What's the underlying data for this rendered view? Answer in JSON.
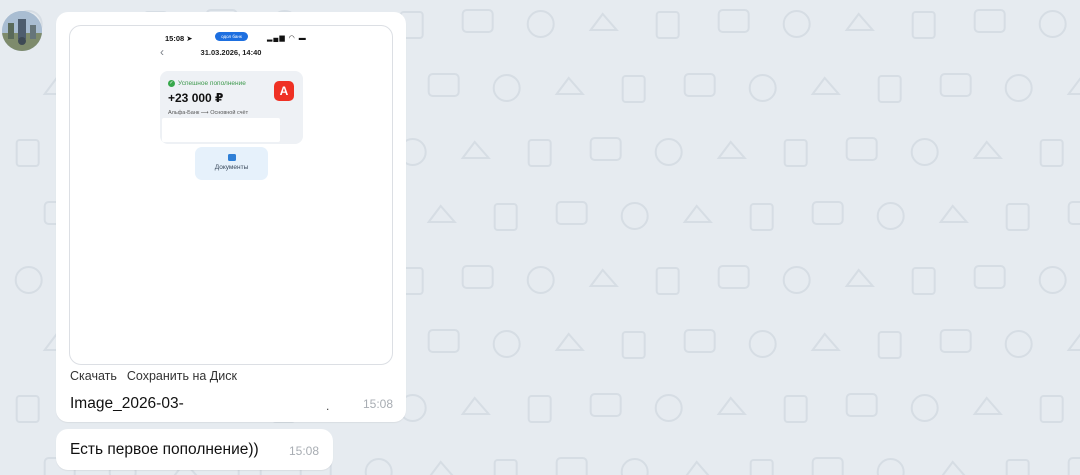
{
  "colors": {
    "wallpaper": "#e6ebf0",
    "bubble": "#ffffff",
    "success_green": "#37a84b",
    "bank_red": "#ef3124",
    "status_pill_blue": "#1d6fe0",
    "docs_button_bg": "#e6f1fb",
    "timestamp_grey": "#a8adb3"
  },
  "chat": {
    "messages": [
      {
        "type": "image-file",
        "preview": {
          "status_bar": {
            "time": "15:08 ➤",
            "pill": "одол банк",
            "icons": "▂▄▆ ◠ ▬"
          },
          "date": "31.03.2026, 14:40",
          "transaction": {
            "status": "Успешное пополнение",
            "amount": "+23 000 ₽",
            "route": "Альфа-Банк ⟶ Основной счёт",
            "bank_logo": "А"
          },
          "docs_button": "Документы"
        },
        "actions": {
          "download": "Скачать",
          "save_to_disk": "Сохранить на Диск"
        },
        "file_name": "Image_2026-03-",
        "redaction_dot": ".",
        "time": "15:08"
      },
      {
        "type": "text",
        "text": "Есть первое пополнение))",
        "time": "15:08"
      }
    ]
  }
}
